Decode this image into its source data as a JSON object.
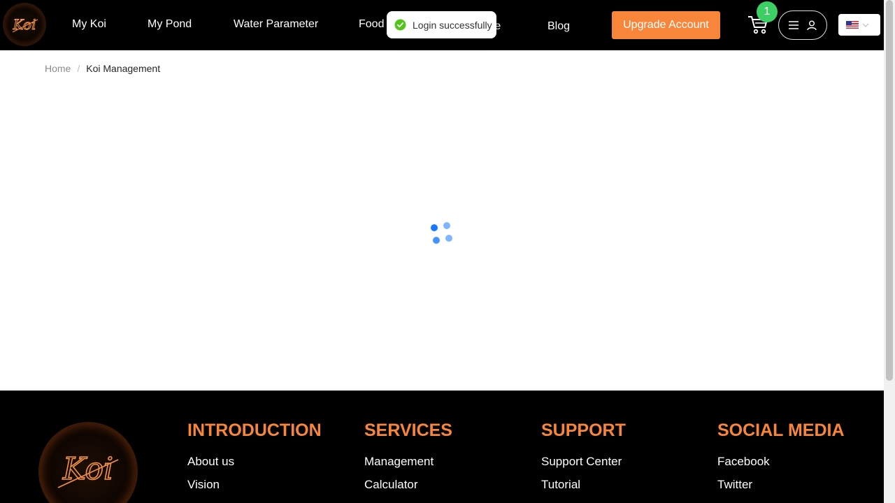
{
  "header": {
    "logo_text": "Koi",
    "nav": [
      {
        "label": "My Koi"
      },
      {
        "label": "My Pond"
      },
      {
        "label": "Water Parameter"
      },
      {
        "label": "Food"
      },
      {
        "label": "re"
      },
      {
        "label": "Blog"
      }
    ],
    "upgrade_label": "Upgrade Account",
    "cart_count": "1",
    "language_flag": "us-flag-icon"
  },
  "toast": {
    "message": "Login successfully",
    "icon": "check-circle-icon",
    "color": "#52c41a"
  },
  "breadcrumb": {
    "home": "Home",
    "separator": "/",
    "current": "Koi Management"
  },
  "loading": {
    "icon": "loading-spinner-icon",
    "color": "#1677ff"
  },
  "footer": {
    "logo_text": "Koi",
    "columns": [
      {
        "heading": "INTRODUCTION",
        "links": [
          "About us",
          "Vision"
        ]
      },
      {
        "heading": "SERVICES",
        "links": [
          "Management",
          "Calculator"
        ]
      },
      {
        "heading": "SUPPORT",
        "links": [
          "Support Center",
          "Tutorial"
        ]
      },
      {
        "heading": "SOCIAL MEDIA",
        "links": [
          "Facebook",
          "Twitter"
        ]
      }
    ]
  },
  "colors": {
    "accent": "#f7863b",
    "header_bg": "#000000",
    "badge": "#3ecf64"
  }
}
